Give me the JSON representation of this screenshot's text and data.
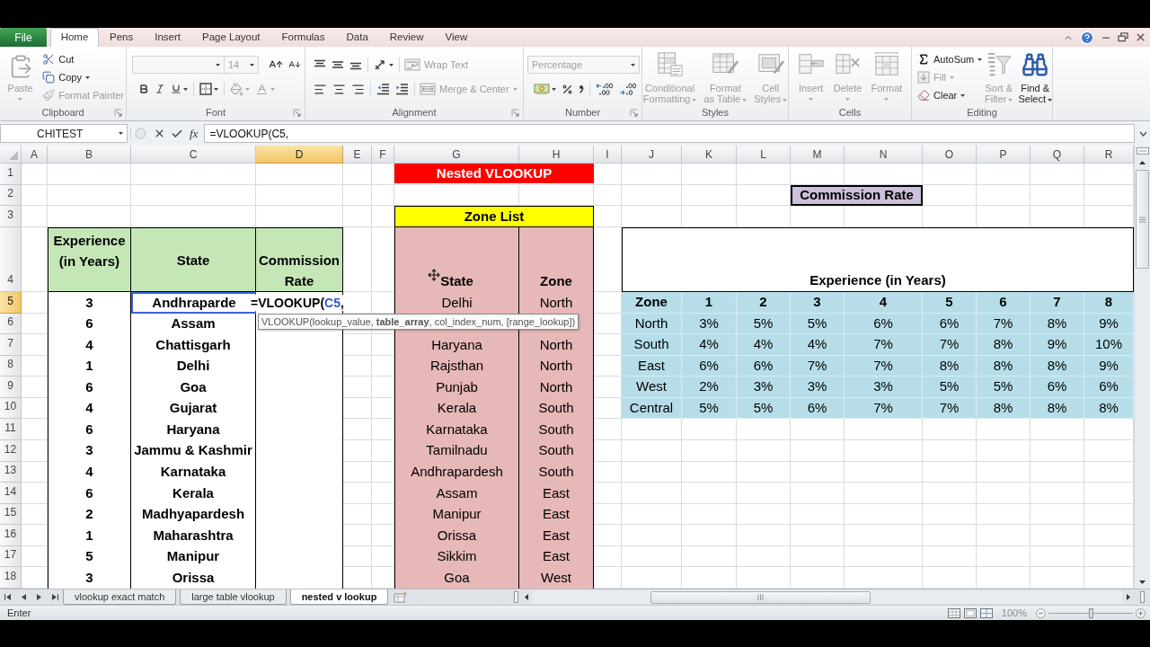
{
  "ribbon_tabs": [
    {
      "label": "File",
      "kind": "file",
      "selected": false
    },
    {
      "label": "Home",
      "kind": "tab",
      "selected": true
    },
    {
      "label": "Pens",
      "kind": "tab",
      "selected": false
    },
    {
      "label": "Insert",
      "kind": "tab",
      "selected": false
    },
    {
      "label": "Page Layout",
      "kind": "tab",
      "selected": false
    },
    {
      "label": "Formulas",
      "kind": "tab",
      "selected": false
    },
    {
      "label": "Data",
      "kind": "tab",
      "selected": false
    },
    {
      "label": "Review",
      "kind": "tab",
      "selected": false
    },
    {
      "label": "View",
      "kind": "tab",
      "selected": false
    }
  ],
  "clipboard": {
    "label": "Clipboard",
    "paste": {
      "label": "Paste",
      "disabled": true
    },
    "commands": [
      {
        "label": "Cut",
        "disabled": false
      },
      {
        "label": "Copy",
        "disabled": false
      },
      {
        "label": "Format Painter",
        "disabled": true
      }
    ]
  },
  "font": {
    "label": "Font",
    "size": {
      "value": "14",
      "disabled": true
    },
    "tools": [
      {
        "kind": "grow",
        "disabled": false
      },
      {
        "kind": "shrink",
        "disabled": false
      },
      {
        "kind": "bold",
        "disabled": false
      },
      {
        "kind": "italic",
        "disabled": false
      },
      {
        "kind": "underline",
        "disabled": false
      },
      {
        "kind": "border",
        "disabled": false
      },
      {
        "kind": "fill",
        "disabled": true
      },
      {
        "kind": "font_color",
        "disabled": true
      }
    ]
  },
  "alignment": {
    "label": "Alignment",
    "tools": [
      {
        "kind": "align_top"
      },
      {
        "kind": "align_middle"
      },
      {
        "kind": "align_bottom"
      },
      {
        "kind": "orientation"
      },
      {
        "kind": "align_left"
      },
      {
        "kind": "align_center"
      },
      {
        "kind": "align_right"
      },
      {
        "kind": "indent_decrease"
      },
      {
        "kind": "indent_increase"
      }
    ],
    "commands": [
      {
        "label": "Wrap Text",
        "disabled": true
      },
      {
        "label": "Merge & Center",
        "disabled": true
      }
    ]
  },
  "number": {
    "label": "Number",
    "format": {
      "value": "Percentage",
      "disabled": true
    },
    "tools": [
      {
        "kind": "currency"
      },
      {
        "kind": "percent"
      },
      {
        "kind": "comma"
      },
      {
        "kind": "decimal_increase"
      },
      {
        "kind": "decimal_decrease"
      }
    ]
  },
  "styles": {
    "label": "Styles",
    "commands": [
      {
        "label": "Conditional\nFormatting",
        "kind": "conditional",
        "disabled": true
      },
      {
        "label": "Format\nas Table",
        "kind": "table",
        "disabled": true
      },
      {
        "label": "Cell\nStyles",
        "kind": "cell_styles",
        "disabled": true
      }
    ]
  },
  "cells": {
    "label": "Cells",
    "commands": [
      {
        "label": "Insert",
        "kind": "insert",
        "disabled": true
      },
      {
        "label": "Delete",
        "kind": "delete",
        "disabled": true
      },
      {
        "label": "Format",
        "kind": "format",
        "disabled": true
      }
    ]
  },
  "editing": {
    "label": "Editing",
    "commands": [
      {
        "label": "AutoSum",
        "kind": "autosum",
        "disabled": false
      },
      {
        "label": "Fill",
        "kind": "fill",
        "disabled": true
      },
      {
        "label": "Clear",
        "kind": "clear",
        "disabled": false
      },
      {
        "label": "Sort &\nFilter",
        "kind": "sort",
        "disabled": true
      },
      {
        "label": "Find &\nSelect",
        "kind": "find",
        "disabled": false
      }
    ]
  },
  "formula_bar": {
    "name_box": "CHITEST",
    "insert_function": "fx",
    "formula": "=VLOOKUP(C5,"
  },
  "columns": [
    {
      "label": "A",
      "selected": false
    },
    {
      "label": "B",
      "selected": false
    },
    {
      "label": "C",
      "selected": false
    },
    {
      "label": "D",
      "selected": true
    },
    {
      "label": "E",
      "selected": false
    },
    {
      "label": "F",
      "selected": false
    },
    {
      "label": "G",
      "selected": false
    },
    {
      "label": "H",
      "selected": false
    },
    {
      "label": "I",
      "selected": false
    },
    {
      "label": "J",
      "selected": false
    },
    {
      "label": "K",
      "selected": false
    },
    {
      "label": "L",
      "selected": false
    },
    {
      "label": "M",
      "selected": false
    },
    {
      "label": "N",
      "selected": false
    },
    {
      "label": "O",
      "selected": false
    },
    {
      "label": "P",
      "selected": false
    },
    {
      "label": "Q",
      "selected": false
    },
    {
      "label": "R",
      "selected": false
    }
  ],
  "rows": [
    {
      "label": "1",
      "selected": false
    },
    {
      "label": "2",
      "selected": false
    },
    {
      "label": "3",
      "selected": false
    },
    {
      "label": "4",
      "selected": false
    },
    {
      "label": "5",
      "selected": true
    },
    {
      "label": "6",
      "selected": false
    },
    {
      "label": "7",
      "selected": false
    },
    {
      "label": "8",
      "selected": false
    },
    {
      "label": "9",
      "selected": false
    },
    {
      "label": "10",
      "selected": false
    },
    {
      "label": "11",
      "selected": false
    },
    {
      "label": "12",
      "selected": false
    },
    {
      "label": "13",
      "selected": false
    },
    {
      "label": "14",
      "selected": false
    },
    {
      "label": "15",
      "selected": false
    },
    {
      "label": "16",
      "selected": false
    },
    {
      "label": "17",
      "selected": false
    },
    {
      "label": "18",
      "selected": false
    }
  ],
  "state_table": {
    "columns": [
      "Experience (in Years)",
      "State",
      "Commission Rate"
    ],
    "rows": [
      {
        "experience": "3",
        "state": "Andhraparde",
        "referenced": true,
        "entry": [
          {
            "text": "=VLOOKUP(",
            "kind": "text"
          },
          {
            "text": "C5",
            "kind": "reference"
          },
          {
            "text": ",",
            "kind": "text"
          }
        ]
      },
      {
        "experience": "6",
        "state": "Assam",
        "referenced": false
      },
      {
        "experience": "4",
        "state": "Chattisgarh",
        "referenced": false
      },
      {
        "experience": "1",
        "state": "Delhi",
        "referenced": false
      },
      {
        "experience": "6",
        "state": "Goa",
        "referenced": false
      },
      {
        "experience": "4",
        "state": "Gujarat",
        "referenced": false
      },
      {
        "experience": "6",
        "state": "Haryana",
        "referenced": false
      },
      {
        "experience": "3",
        "state": "Jammu & Kashmir",
        "referenced": false
      },
      {
        "experience": "4",
        "state": "Karnataka",
        "referenced": false
      },
      {
        "experience": "6",
        "state": "Kerala",
        "referenced": false
      },
      {
        "experience": "2",
        "state": "Madhyapardesh",
        "referenced": false
      },
      {
        "experience": "1",
        "state": "Maharashtra",
        "referenced": false
      },
      {
        "experience": "5",
        "state": "Manipur",
        "referenced": false
      },
      {
        "experience": "3",
        "state": "Orissa",
        "referenced": false
      }
    ]
  },
  "banner": "Nested VLOOKUP",
  "zone_table": {
    "title": "Zone List",
    "columns": [
      "State",
      "Zone"
    ],
    "rows": [
      {
        "state": "Delhi",
        "zone": "North"
      },
      {},
      {
        "state": "Haryana",
        "zone": "North"
      },
      {
        "state": "Rajsthan",
        "zone": "North"
      },
      {
        "state": "Punjab",
        "zone": "North"
      },
      {
        "state": "Kerala",
        "zone": "South"
      },
      {
        "state": "Karnataka",
        "zone": "South"
      },
      {
        "state": "Tamilnadu",
        "zone": "South"
      },
      {
        "state": "Andhrapardesh",
        "zone": "South"
      },
      {
        "state": "Assam",
        "zone": "East"
      },
      {
        "state": "Manipur",
        "zone": "East"
      },
      {
        "state": "Orissa",
        "zone": "East"
      },
      {
        "state": "Sikkim",
        "zone": "East"
      },
      {
        "state": "Goa",
        "zone": "West"
      }
    ]
  },
  "rate_table": {
    "title": "Commission Rate",
    "header": "Experience (in Years)",
    "columns": [
      "Zone",
      "1",
      "2",
      "3",
      "4",
      "5",
      "6",
      "7",
      "8"
    ],
    "rows": [
      {
        "zone": "North",
        "rates": [
          "3%",
          "5%",
          "5%",
          "6%",
          "6%",
          "7%",
          "8%",
          "9%"
        ]
      },
      {
        "zone": "South",
        "rates": [
          "4%",
          "4%",
          "4%",
          "7%",
          "7%",
          "8%",
          "9%",
          "10%"
        ]
      },
      {
        "zone": "East",
        "rates": [
          "6%",
          "6%",
          "7%",
          "7%",
          "8%",
          "8%",
          "8%",
          "9%"
        ]
      },
      {
        "zone": "West",
        "rates": [
          "2%",
          "3%",
          "3%",
          "3%",
          "5%",
          "5%",
          "6%",
          "6%"
        ]
      },
      {
        "zone": "Central",
        "rates": [
          "5%",
          "5%",
          "6%",
          "7%",
          "7%",
          "8%",
          "8%",
          "8%"
        ]
      }
    ]
  },
  "tooltip": "VLOOKUP(lookup_value, **table_array**, col_index_num, [range_lookup])",
  "sheet_tabs": [
    {
      "label": "vlookup exact match",
      "selected": false
    },
    {
      "label": "large table vlookup",
      "selected": false
    },
    {
      "label": "nested v lookup",
      "selected": true
    }
  ],
  "status_bar": {
    "mode": "Enter",
    "zoom": "100%",
    "zoom_slider": {
      "level": 0.5
    }
  }
}
